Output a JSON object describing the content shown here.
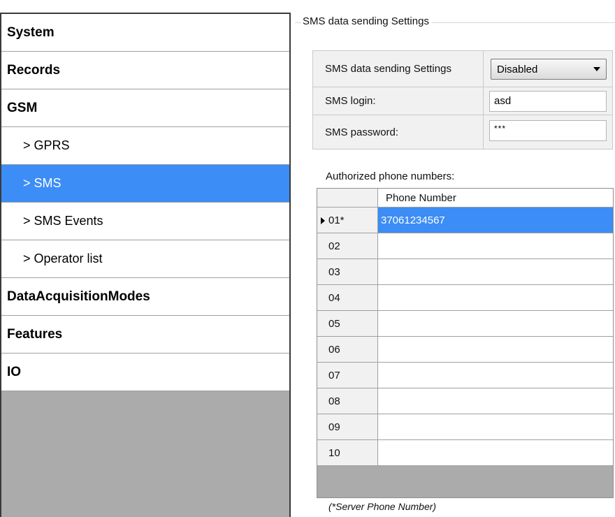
{
  "sidebar": {
    "items": [
      {
        "label": "System"
      },
      {
        "label": "Records"
      },
      {
        "label": "GSM"
      },
      {
        "label": "> GPRS"
      },
      {
        "label": "> SMS"
      },
      {
        "label": "> SMS Events"
      },
      {
        "label": "> Operator list"
      },
      {
        "label": "DataAcquisitionModes"
      },
      {
        "label": "Features"
      },
      {
        "label": "IO"
      }
    ],
    "active_item": "> SMS"
  },
  "group": {
    "title": "SMS data sending Settings"
  },
  "settings": {
    "sending_label": "SMS data sending Settings",
    "sending_value": "Disabled",
    "login_label": "SMS login:",
    "login_value": "asd",
    "password_label": "SMS password:",
    "password_value": "***"
  },
  "phones": {
    "label": "Authorized phone numbers:",
    "column_header": "Phone Number",
    "rows": [
      {
        "index": "01*",
        "number": "37061234567"
      },
      {
        "index": "02",
        "number": ""
      },
      {
        "index": "03",
        "number": ""
      },
      {
        "index": "04",
        "number": ""
      },
      {
        "index": "05",
        "number": ""
      },
      {
        "index": "06",
        "number": ""
      },
      {
        "index": "07",
        "number": ""
      },
      {
        "index": "08",
        "number": ""
      },
      {
        "index": "09",
        "number": ""
      },
      {
        "index": "10",
        "number": ""
      }
    ]
  },
  "footnote": "(*Server Phone Number)",
  "colors": {
    "selection": "#3c8df5",
    "sidebar_empty": "#ababab"
  }
}
